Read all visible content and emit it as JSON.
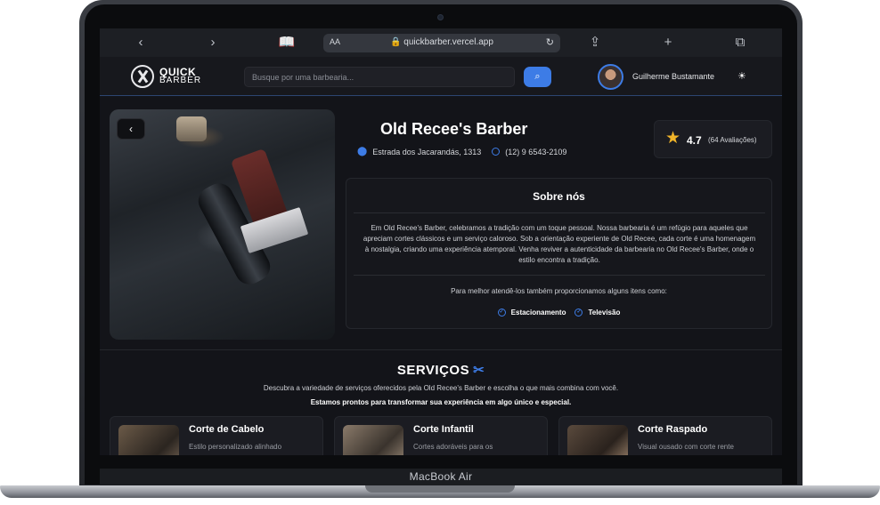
{
  "device": {
    "label": "MacBook Air"
  },
  "browser": {
    "text_size_label": "AA",
    "url": "quickbarber.vercel.app",
    "icons": [
      "chevron-left-icon",
      "chevron-right-icon",
      "book-icon",
      "text-size-icon",
      "lock-icon",
      "reload-icon",
      "share-icon",
      "plus-icon",
      "tabs-icon"
    ]
  },
  "header": {
    "logo_top": "QUICK",
    "logo_bottom": "BARBER",
    "search_placeholder": "Busque por uma barbearia...",
    "user_name": "Guilherme Bustamante",
    "icons": [
      "search-icon",
      "sun-icon"
    ]
  },
  "barbershop": {
    "name": "Old Recee's Barber",
    "address": "Estrada dos Jacarandás, 1313",
    "phone": "(12) 9 6543-2109",
    "rating": "4.7",
    "reviews": "(64 Avaliações)"
  },
  "about": {
    "title": "Sobre nós",
    "text": "Em Old Recee's Barber, celebramos a tradição com um toque pessoal. Nossa barbearia é um refúgio para aqueles que apreciam cortes clássicos e um serviço caloroso. Sob a orientação experiente de Old Recee, cada corte é uma homenagem à nostalgia, criando uma experiência atemporal. Venha reviver a autenticidade da barbearia no Old Recee's Barber, onde o estilo encontra a tradição.",
    "amenities_intro": "Para melhor atendê-los também proporcionamos alguns itens como:",
    "amenities": [
      "Estacionamento",
      "Televisão"
    ]
  },
  "services": {
    "title": "SERVIÇOS",
    "description": "Descubra a variedade de serviços oferecidos pela Old Recee's Barber e escolha o que mais combina com você.",
    "tagline": "Estamos prontos para transformar sua experiência em algo único e especial.",
    "items": [
      {
        "title": "Corte de Cabelo",
        "description": "Estilo personalizado alinhado"
      },
      {
        "title": "Corte Infantil",
        "description": "Cortes adoráveis para os"
      },
      {
        "title": "Corte Raspado",
        "description": "Visual ousado com corte rente"
      }
    ]
  },
  "colors": {
    "accent": "#3d7ce6",
    "background": "#131419",
    "star": "#f0b429"
  }
}
